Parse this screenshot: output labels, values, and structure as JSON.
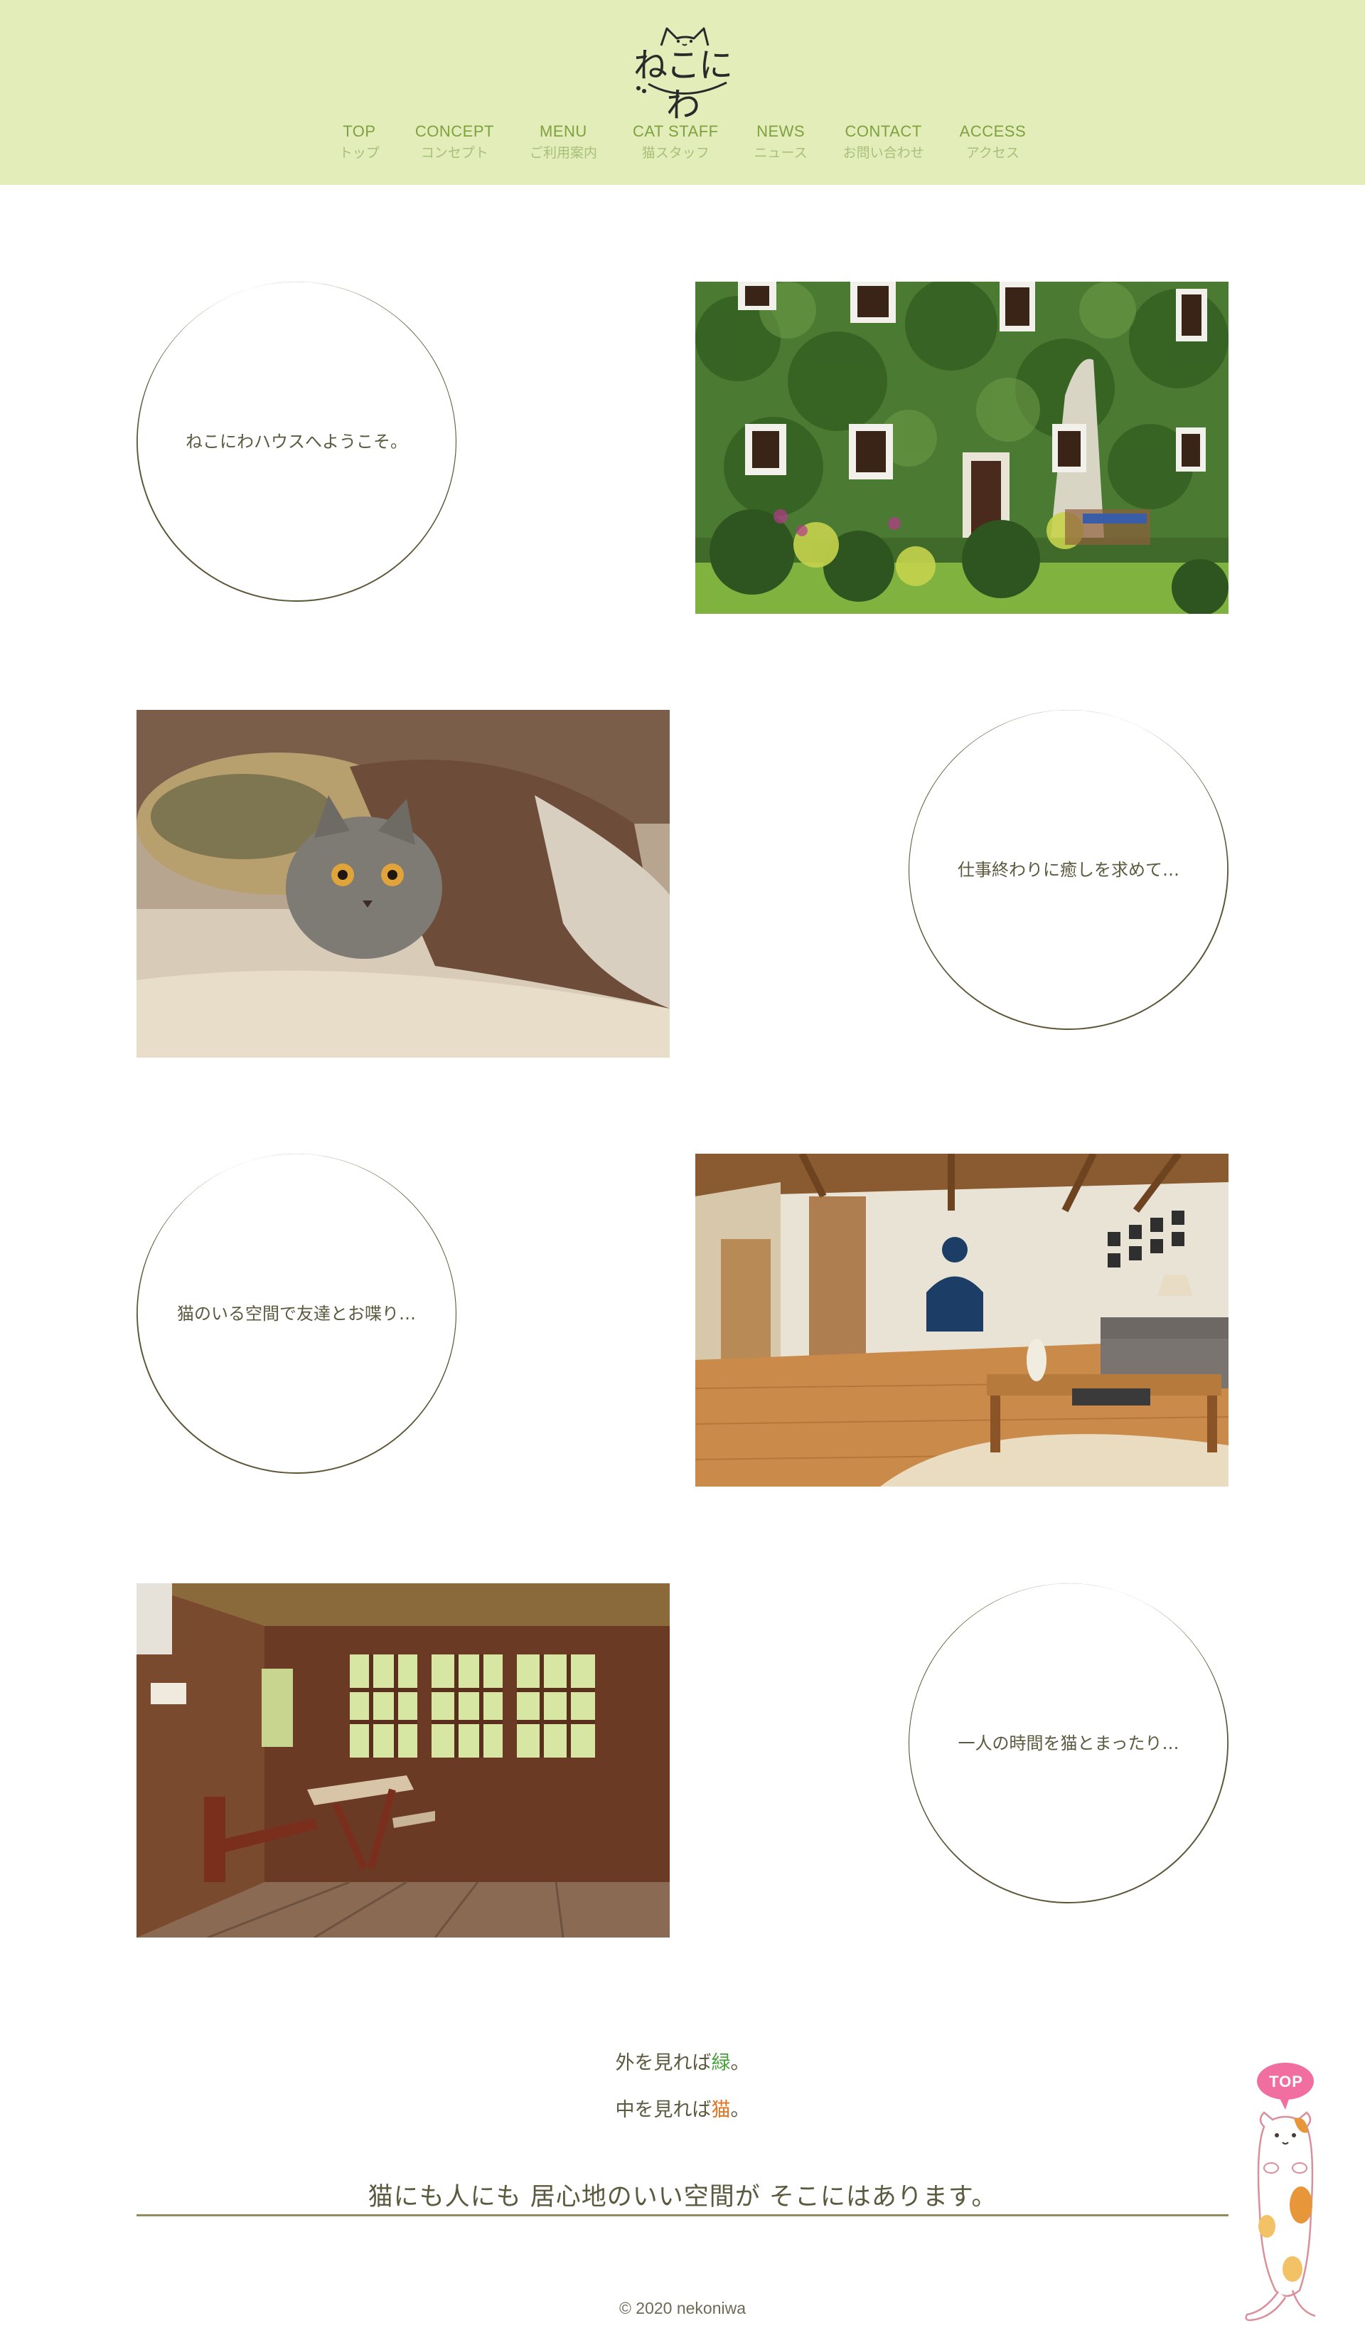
{
  "header": {
    "logo_text": "ねこにわ",
    "nav": [
      {
        "en": "TOP",
        "jp": "トップ"
      },
      {
        "en": "CONCEPT",
        "jp": "コンセプト"
      },
      {
        "en": "MENU",
        "jp": "ご利用案内"
      },
      {
        "en": "CAT STAFF",
        "jp": "猫スタッフ"
      },
      {
        "en": "NEWS",
        "jp": "ニュース"
      },
      {
        "en": "CONTACT",
        "jp": "お問い合わせ"
      },
      {
        "en": "ACCESS",
        "jp": "アクセス"
      }
    ]
  },
  "sections": [
    {
      "text": "ねこにわハウスへようこそ。",
      "image": "ivy-covered-house-photo"
    },
    {
      "text": "仕事終わりに癒しを求めて…",
      "image": "cat-under-blanket-photo"
    },
    {
      "text": "猫のいる空間で友達とお喋り…",
      "image": "living-room-photo"
    },
    {
      "text": "一人の時間を猫とまったり…",
      "image": "rustic-wooden-room-photo"
    }
  ],
  "lead": {
    "line1_prefix": "外を見れば",
    "line1_highlight": "緑",
    "line1_suffix": "。",
    "line2_prefix": "中を見れば",
    "line2_highlight": "猫",
    "line2_suffix": "。"
  },
  "tagline": "猫にも人にも 居心地のいい空間が そこにはあります。",
  "footer": {
    "copyright": "© 2020 nekoniwa"
  },
  "top_button": {
    "label": "TOP"
  },
  "colors": {
    "header_bg": "#e2edb9",
    "nav_en": "#7fa13f",
    "nav_jp": "#a9c07a",
    "text": "#5c5a3e",
    "highlight_green": "#4aa13c",
    "highlight_orange": "#e6731f",
    "circle_line": "#5d5636"
  }
}
